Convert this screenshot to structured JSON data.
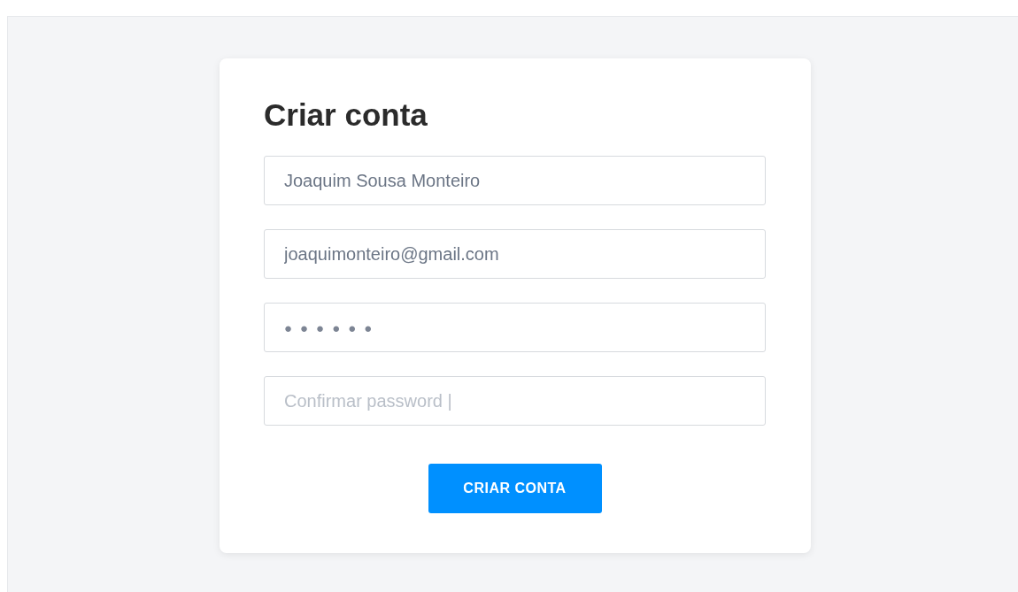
{
  "card": {
    "title": "Criar conta",
    "fields": [
      {
        "kind": "text",
        "value": "Joaquim Sousa Monteiro"
      },
      {
        "kind": "text",
        "value": "joaquimonteiro@gmail.com"
      },
      {
        "kind": "password",
        "value": "●●●●●●"
      },
      {
        "kind": "text",
        "placeholder": "Confirmar password |"
      }
    ],
    "button": "CRIAR CONTA"
  }
}
